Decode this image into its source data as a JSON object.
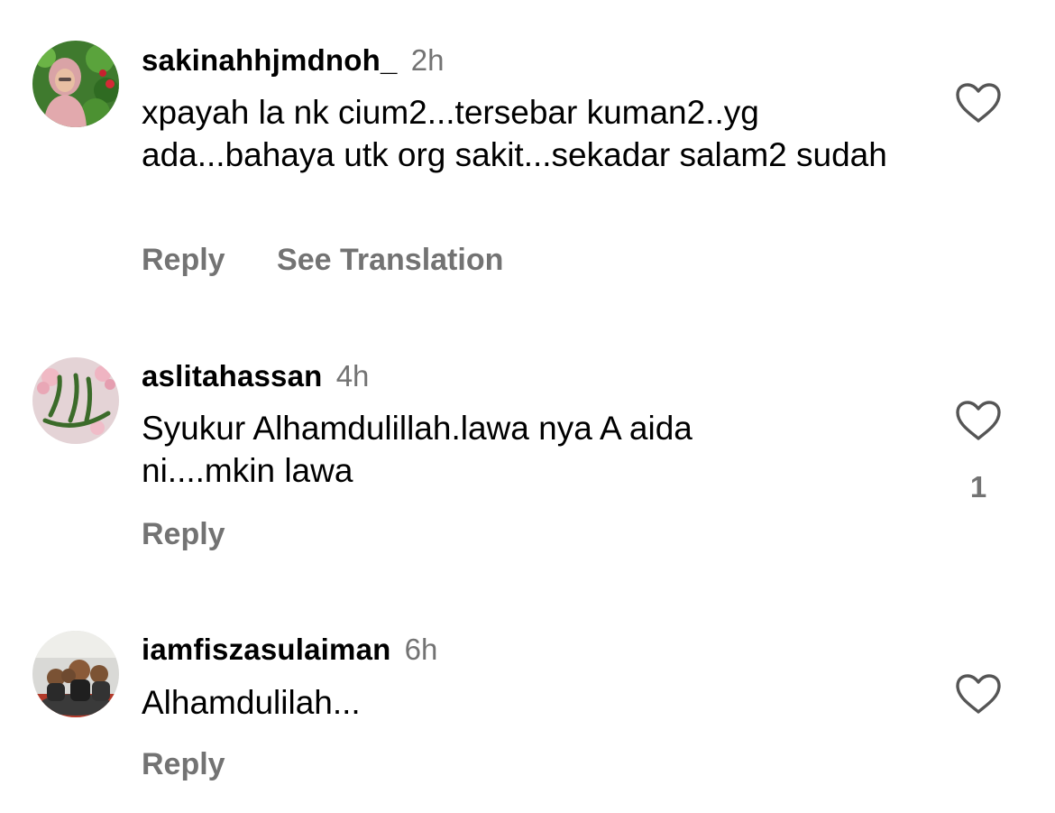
{
  "comments": [
    {
      "username": "sakinahhjmdnoh_",
      "time": "2h",
      "text": "xpayah la nk cium2...tersebar kuman2..yg ada...bahaya utk org sakit...sekadar salam2 sudah",
      "reply_label": "Reply",
      "translate_label": "See Translation",
      "likes": ""
    },
    {
      "username": "aslitahassan",
      "time": "4h",
      "text": "Syukur Alhamdulillah.lawa nya A aida ni....mkin lawa",
      "reply_label": "Reply",
      "likes": "1"
    },
    {
      "username": "iamfiszasulaiman",
      "time": "6h",
      "text": "Alhamdulilah...",
      "reply_label": "Reply",
      "likes": ""
    }
  ],
  "icons": {
    "like": "heart-outline-icon"
  },
  "colors": {
    "secondary_text": "#737373",
    "primary_text": "#000000",
    "background": "#ffffff"
  }
}
